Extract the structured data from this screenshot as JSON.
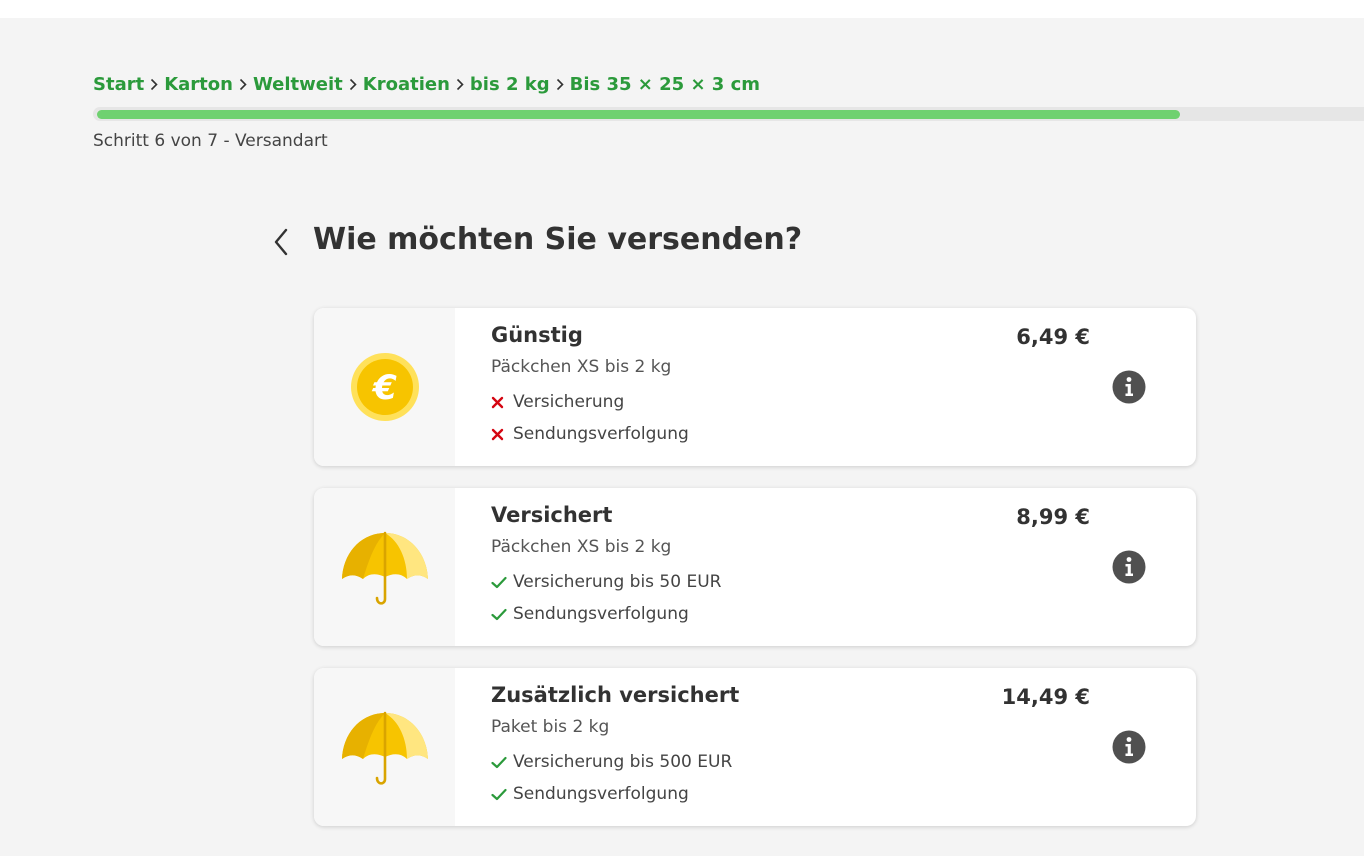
{
  "breadcrumb": {
    "items": [
      "Start",
      "Karton",
      "Weltweit",
      "Kroatien",
      "bis 2 kg",
      "Bis 35 × 25 × 3 cm"
    ],
    "color": "#2b9a3b"
  },
  "progress": {
    "fraction": 0.8571,
    "fill_color": "#6fd170",
    "step_text": "Schritt 6 von 7 - Versandart"
  },
  "heading": "Wie möchten Sie versenden?",
  "options": [
    {
      "title": "Günstig",
      "subtitle": "Päckchen XS bis 2 kg",
      "price": "6,49 €",
      "icon": "euro-coin-icon",
      "features": [
        {
          "text": "Versicherung",
          "included": false
        },
        {
          "text": "Sendungsverfolgung",
          "included": false
        }
      ]
    },
    {
      "title": "Versichert",
      "subtitle": "Päckchen XS bis 2 kg",
      "price": "8,99 €",
      "icon": "umbrella-icon",
      "features": [
        {
          "text": "Versicherung bis 50 EUR",
          "included": true
        },
        {
          "text": "Sendungsverfolgung",
          "included": true
        }
      ]
    },
    {
      "title": "Zusätzlich versichert",
      "subtitle": "Paket bis 2 kg",
      "price": "14,49 €",
      "icon": "umbrella-icon",
      "features": [
        {
          "text": "Versicherung bis 500 EUR",
          "included": true
        },
        {
          "text": "Sendungsverfolgung",
          "included": true
        }
      ]
    }
  ],
  "colors": {
    "check": "#2b9a3b",
    "cross": "#d40511",
    "info": "#505050",
    "brand_yellow": "#ffcc00"
  }
}
